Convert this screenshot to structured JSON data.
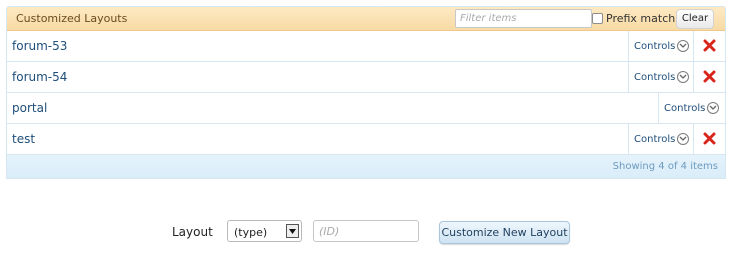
{
  "panel": {
    "title": "Customized Layouts",
    "filter_placeholder": "Filter items",
    "prefix_label": "Prefix match",
    "clear_label": "Clear",
    "rows": [
      {
        "name": "forum-53",
        "controls": "Controls",
        "deletable": true
      },
      {
        "name": "forum-54",
        "controls": "Controls",
        "deletable": true
      },
      {
        "name": "portal",
        "controls": "Controls",
        "deletable": false
      },
      {
        "name": "test",
        "controls": "Controls",
        "deletable": true
      }
    ],
    "count_text": "Showing 4 of 4 items"
  },
  "form": {
    "layout_label": "Layout",
    "type_value": "(type)",
    "id_placeholder": "(ID)",
    "customize_label": "Customize New Layout"
  },
  "colors": {
    "header_bg": "#fbe2b4",
    "link": "#1f4e79",
    "delete": "#d9261c",
    "footer_bg": "#dcefff"
  }
}
